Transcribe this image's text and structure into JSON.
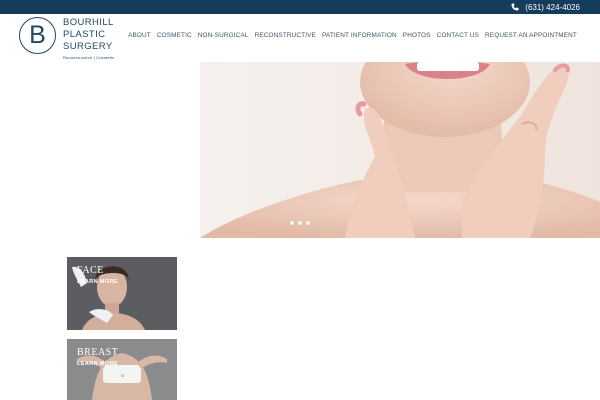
{
  "topbar": {
    "phone": "(631) 424-4026",
    "phone_icon": "phone-icon"
  },
  "logo": {
    "letter": "B",
    "line1": "BOURHILL",
    "line2": "PLASTIC",
    "line3": "SURGERY",
    "tagline": "Reconstructive | Cosmetic"
  },
  "nav": {
    "items": [
      {
        "label": "ABOUT"
      },
      {
        "label": "COSMETIC"
      },
      {
        "label": "NON-SURGICAL"
      },
      {
        "label": "RECONSTRUCTIVE"
      },
      {
        "label": "PATIENT INFORMATION"
      },
      {
        "label": "PHOTOS"
      },
      {
        "label": "CONTACT US"
      },
      {
        "label": "REQUEST AN APPOINTMENT"
      }
    ]
  },
  "hero": {
    "slide_count": 3,
    "active_slide": 1
  },
  "cards": [
    {
      "title": "FACE",
      "link": "LEARN MORE"
    },
    {
      "title": "BREAST",
      "link": "LEARN MORE"
    }
  ],
  "colors": {
    "topbar": "#163c5c",
    "brand": "#1f4866",
    "nav_text": "#3e5366"
  }
}
